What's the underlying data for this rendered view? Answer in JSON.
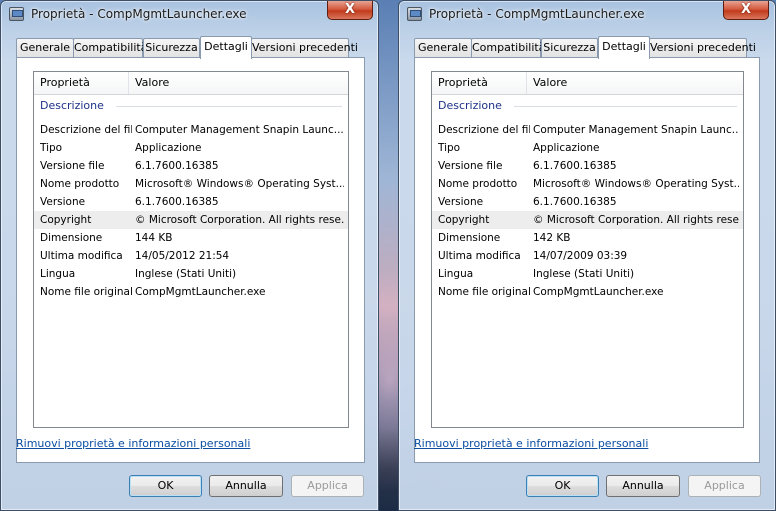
{
  "windows": [
    {
      "title": "Proprietà - CompMgmtLauncher.exe",
      "close_label": "X",
      "tabs": [
        {
          "label": "Generale",
          "active": false
        },
        {
          "label": "Compatibilità",
          "active": false
        },
        {
          "label": "Sicurezza",
          "active": false
        },
        {
          "label": "Dettagli",
          "active": true
        },
        {
          "label": "Versioni precedenti",
          "active": false
        }
      ],
      "columns": {
        "property": "Proprietà",
        "value": "Valore"
      },
      "group": "Descrizione",
      "rows": [
        {
          "key": "Descrizione del file",
          "value": "Computer Management Snapin Launc..."
        },
        {
          "key": "Tipo",
          "value": "Applicazione"
        },
        {
          "key": "Versione file",
          "value": "6.1.7600.16385"
        },
        {
          "key": "Nome prodotto",
          "value": "Microsoft® Windows® Operating Syst..."
        },
        {
          "key": "Versione",
          "value": "6.1.7600.16385"
        },
        {
          "key": "Copyright",
          "value": "© Microsoft Corporation. All rights rese...",
          "selected": true
        },
        {
          "key": "Dimensione",
          "value": "144 KB"
        },
        {
          "key": "Ultima modifica",
          "value": "14/05/2012 21:54"
        },
        {
          "key": "Lingua",
          "value": "Inglese (Stati Uniti)"
        },
        {
          "key": "Nome file originale",
          "value": "CompMgmtLauncher.exe"
        }
      ],
      "remove_link": "Rimuovi proprietà e informazioni personali",
      "buttons": {
        "ok": "OK",
        "cancel": "Annulla",
        "apply": "Applica"
      }
    },
    {
      "title": "Proprietà - CompMgmtLauncher.exe",
      "close_label": "X",
      "tabs": [
        {
          "label": "Generale",
          "active": false
        },
        {
          "label": "Compatibilità",
          "active": false
        },
        {
          "label": "Sicurezza",
          "active": false
        },
        {
          "label": "Dettagli",
          "active": true
        },
        {
          "label": "Versioni precedenti",
          "active": false
        }
      ],
      "columns": {
        "property": "Proprietà",
        "value": "Valore"
      },
      "group": "Descrizione",
      "rows": [
        {
          "key": "Descrizione del file",
          "value": "Computer Management Snapin Launc..."
        },
        {
          "key": "Tipo",
          "value": "Applicazione"
        },
        {
          "key": "Versione file",
          "value": "6.1.7600.16385"
        },
        {
          "key": "Nome prodotto",
          "value": "Microsoft® Windows® Operating Syst..."
        },
        {
          "key": "Versione",
          "value": "6.1.7600.16385"
        },
        {
          "key": "Copyright",
          "value": "© Microsoft Corporation. All rights rese...",
          "selected": true
        },
        {
          "key": "Dimensione",
          "value": "142 KB"
        },
        {
          "key": "Ultima modifica",
          "value": "14/07/2009 03:39"
        },
        {
          "key": "Lingua",
          "value": "Inglese (Stati Uniti)"
        },
        {
          "key": "Nome file originale",
          "value": "CompMgmtLauncher.exe"
        }
      ],
      "remove_link": "Rimuovi proprietà e informazioni personali",
      "buttons": {
        "ok": "OK",
        "cancel": "Annulla",
        "apply": "Applica"
      }
    }
  ]
}
